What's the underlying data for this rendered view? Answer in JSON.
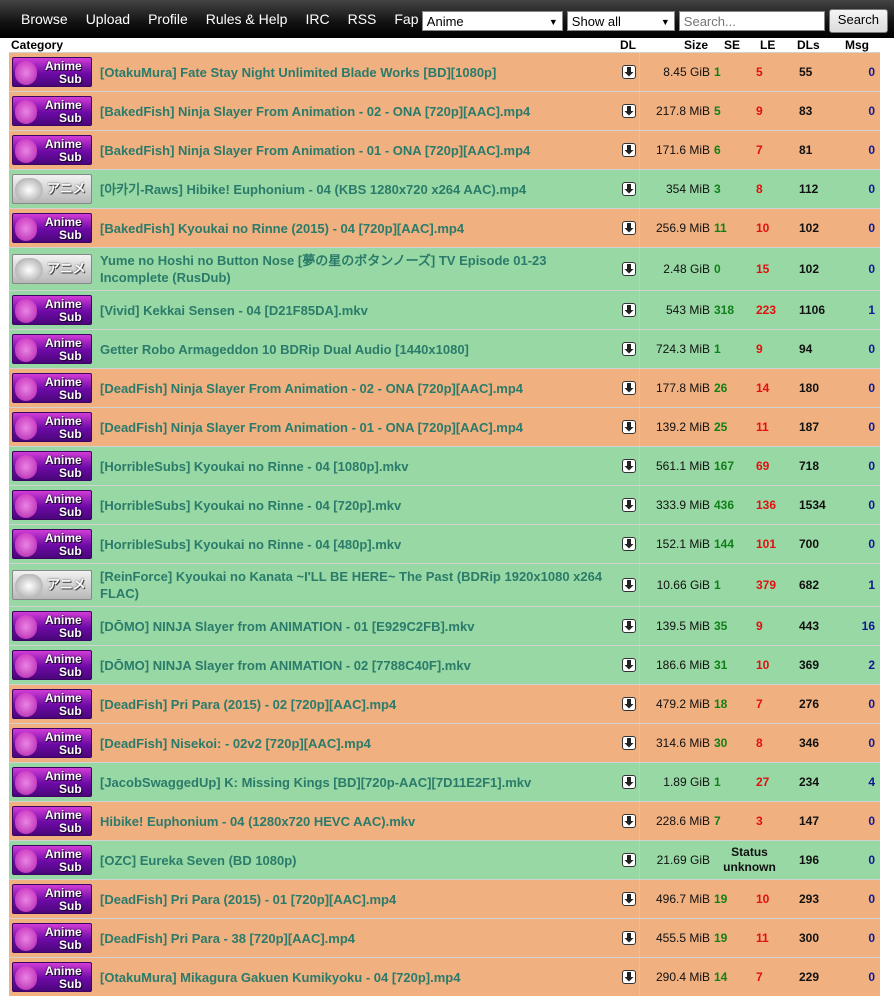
{
  "nav": [
    "Browse",
    "Upload",
    "Profile",
    "Rules & Help",
    "IRC",
    "RSS",
    "Fap"
  ],
  "filters": {
    "category": "Anime",
    "status": "Show all",
    "search_placeholder": "Search...",
    "search_button": "Search"
  },
  "columns": {
    "category": "Category",
    "dl": "DL",
    "size": "Size",
    "se": "SE",
    "le": "LE",
    "dls": "DLs",
    "msg": "Msg"
  },
  "colors": {
    "orange_row": "#f0b080",
    "green_row": "#98d8a4",
    "name": "#2a7b6a",
    "seeders": "#11801a",
    "leechers": "#e01010",
    "msg": "#0f1890"
  },
  "rows": [
    {
      "cat": "sub",
      "badge1": "Anime",
      "badge2": "Sub",
      "name": "[OtakuMura] Fate Stay Night Unlimited Blade Works [BD][1080p]",
      "size": "8.45 GiB",
      "se": "1",
      "le": "5",
      "dls": "55",
      "msg": "0",
      "color": "o"
    },
    {
      "cat": "sub",
      "badge1": "Anime",
      "badge2": "Sub",
      "name": "[BakedFish] Ninja Slayer From Animation - 02 - ONA [720p][AAC].mp4",
      "size": "217.8 MiB",
      "se": "5",
      "le": "9",
      "dls": "83",
      "msg": "0",
      "color": "o"
    },
    {
      "cat": "sub",
      "badge1": "Anime",
      "badge2": "Sub",
      "name": "[BakedFish] Ninja Slayer From Animation - 01 - ONA [720p][AAC].mp4",
      "size": "171.6 MiB",
      "se": "6",
      "le": "7",
      "dls": "81",
      "msg": "0",
      "color": "o"
    },
    {
      "cat": "raw",
      "badge1": "アニメ",
      "badge2": "",
      "name": "[아카기-Raws] Hibike! Euphonium - 04 (KBS 1280x720 x264 AAC).mp4",
      "size": "354 MiB",
      "se": "3",
      "le": "8",
      "dls": "112",
      "msg": "0",
      "color": "g"
    },
    {
      "cat": "sub",
      "badge1": "Anime",
      "badge2": "Sub",
      "name": "[BakedFish] Kyoukai no Rinne (2015) - 04 [720p][AAC].mp4",
      "size": "256.9 MiB",
      "se": "11",
      "le": "10",
      "dls": "102",
      "msg": "0",
      "color": "o"
    },
    {
      "cat": "raw",
      "badge1": "アニメ",
      "badge2": "",
      "name": "Yume no Hoshi no Button Nose [夢の星のボタンノーズ] TV Episode 01-23 Incomplete (RusDub)",
      "size": "2.48 GiB",
      "se": "0",
      "le": "15",
      "dls": "102",
      "msg": "0",
      "color": "g",
      "tall": true
    },
    {
      "cat": "sub",
      "badge1": "Anime",
      "badge2": "Sub",
      "name": "[Vivid] Kekkai Sensen - 04 [D21F85DA].mkv",
      "size": "543 MiB",
      "se": "318",
      "le": "223",
      "dls": "1106",
      "msg": "1",
      "color": "g"
    },
    {
      "cat": "sub",
      "badge1": "Anime",
      "badge2": "Sub",
      "name": "Getter Robo Armageddon 10 BDRip Dual Audio [1440x1080]",
      "size": "724.3 MiB",
      "se": "1",
      "le": "9",
      "dls": "94",
      "msg": "0",
      "color": "g"
    },
    {
      "cat": "sub",
      "badge1": "Anime",
      "badge2": "Sub",
      "name": "[DeadFish] Ninja Slayer From Animation - 02 - ONA [720p][AAC].mp4",
      "size": "177.8 MiB",
      "se": "26",
      "le": "14",
      "dls": "180",
      "msg": "0",
      "color": "o"
    },
    {
      "cat": "sub",
      "badge1": "Anime",
      "badge2": "Sub",
      "name": "[DeadFish] Ninja Slayer From Animation - 01 - ONA [720p][AAC].mp4",
      "size": "139.2 MiB",
      "se": "25",
      "le": "11",
      "dls": "187",
      "msg": "0",
      "color": "o"
    },
    {
      "cat": "sub",
      "badge1": "Anime",
      "badge2": "Sub",
      "name": "[HorribleSubs] Kyoukai no Rinne - 04 [1080p].mkv",
      "size": "561.1 MiB",
      "se": "167",
      "le": "69",
      "dls": "718",
      "msg": "0",
      "color": "g"
    },
    {
      "cat": "sub",
      "badge1": "Anime",
      "badge2": "Sub",
      "name": "[HorribleSubs] Kyoukai no Rinne - 04 [720p].mkv",
      "size": "333.9 MiB",
      "se": "436",
      "le": "136",
      "dls": "1534",
      "msg": "0",
      "color": "g"
    },
    {
      "cat": "sub",
      "badge1": "Anime",
      "badge2": "Sub",
      "name": "[HorribleSubs] Kyoukai no Rinne - 04 [480p].mkv",
      "size": "152.1 MiB",
      "se": "144",
      "le": "101",
      "dls": "700",
      "msg": "0",
      "color": "g"
    },
    {
      "cat": "raw",
      "badge1": "アニメ",
      "badge2": "",
      "name": "[ReinForce] Kyoukai no Kanata ~I'LL BE HERE~ The Past (BDRip 1920x1080 x264 FLAC)",
      "size": "10.66 GiB",
      "se": "1",
      "le": "379",
      "dls": "682",
      "msg": "1",
      "color": "g",
      "tall": true
    },
    {
      "cat": "sub",
      "badge1": "Anime",
      "badge2": "Sub",
      "name": "[DŌMO] NINJA Slayer from ANIMATION - 01 [E929C2FB].mkv",
      "size": "139.5 MiB",
      "se": "35",
      "le": "9",
      "dls": "443",
      "msg": "16",
      "color": "g"
    },
    {
      "cat": "sub",
      "badge1": "Anime",
      "badge2": "Sub",
      "name": "[DŌMO] NINJA Slayer from ANIMATION - 02 [7788C40F].mkv",
      "size": "186.6 MiB",
      "se": "31",
      "le": "10",
      "dls": "369",
      "msg": "2",
      "color": "g"
    },
    {
      "cat": "sub",
      "badge1": "Anime",
      "badge2": "Sub",
      "name": "[DeadFish] Pri Para (2015) - 02 [720p][AAC].mp4",
      "size": "479.2 MiB",
      "se": "18",
      "le": "7",
      "dls": "276",
      "msg": "0",
      "color": "o"
    },
    {
      "cat": "sub",
      "badge1": "Anime",
      "badge2": "Sub",
      "name": "[DeadFish] Nisekoi: - 02v2 [720p][AAC].mp4",
      "size": "314.6 MiB",
      "se": "30",
      "le": "8",
      "dls": "346",
      "msg": "0",
      "color": "o"
    },
    {
      "cat": "sub",
      "badge1": "Anime",
      "badge2": "Sub",
      "name": "[JacobSwaggedUp] K: Missing Kings [BD][720p-AAC][7D11E2F1].mkv",
      "size": "1.89 GiB",
      "se": "1",
      "le": "27",
      "dls": "234",
      "msg": "4",
      "color": "g"
    },
    {
      "cat": "sub",
      "badge1": "Anime",
      "badge2": "Sub",
      "name": "Hibike! Euphonium - 04 (1280x720 HEVC AAC).mkv",
      "size": "228.6 MiB",
      "se": "7",
      "le": "3",
      "dls": "147",
      "msg": "0",
      "color": "o"
    },
    {
      "cat": "sub",
      "badge1": "Anime",
      "badge2": "Sub",
      "name": "[OZC] Eureka Seven (BD 1080p)",
      "size": "21.69 GiB",
      "status": "Status unknown",
      "dls": "196",
      "msg": "0",
      "color": "g"
    },
    {
      "cat": "sub",
      "badge1": "Anime",
      "badge2": "Sub",
      "name": "[DeadFish] Pri Para (2015) - 01 [720p][AAC].mp4",
      "size": "496.7 MiB",
      "se": "19",
      "le": "10",
      "dls": "293",
      "msg": "0",
      "color": "o"
    },
    {
      "cat": "sub",
      "badge1": "Anime",
      "badge2": "Sub",
      "name": "[DeadFish] Pri Para - 38 [720p][AAC].mp4",
      "size": "455.5 MiB",
      "se": "19",
      "le": "11",
      "dls": "300",
      "msg": "0",
      "color": "o"
    },
    {
      "cat": "sub",
      "badge1": "Anime",
      "badge2": "Sub",
      "name": "[OtakuMura] Mikagura Gakuen Kumikyoku - 04 [720p].mp4",
      "size": "290.4 MiB",
      "se": "14",
      "le": "7",
      "dls": "229",
      "msg": "0",
      "color": "o"
    }
  ]
}
